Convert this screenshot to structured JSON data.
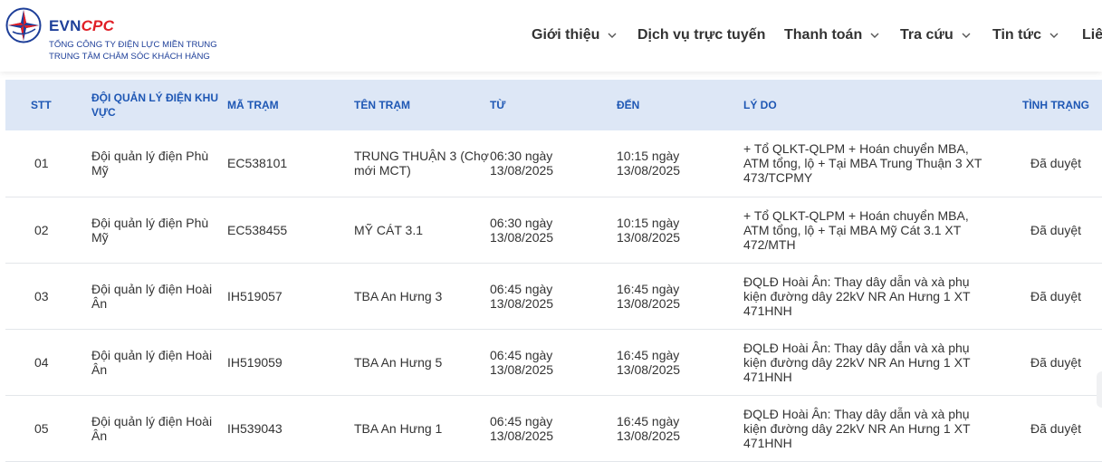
{
  "brand": {
    "name_part1": "EVN",
    "name_part2": "CPC",
    "line1": "TỔNG CÔNG TY ĐIỆN LỰC MIỀN TRUNG",
    "line2": "TRUNG TÂM CHĂM SÓC KHÁCH HÀNG",
    "colors": {
      "primary": "#1e3f99",
      "accent": "#e01f26"
    }
  },
  "nav": {
    "items": [
      {
        "label": "Giới thiệu",
        "has_dropdown": true
      },
      {
        "label": "Dịch vụ trực tuyến",
        "has_dropdown": false
      },
      {
        "label": "Thanh toán",
        "has_dropdown": true
      },
      {
        "label": "Tra cứu",
        "has_dropdown": true
      },
      {
        "label": "Tin tức",
        "has_dropdown": true
      },
      {
        "label": "Liê",
        "has_dropdown": false
      }
    ]
  },
  "table": {
    "columns": {
      "stt": "STT",
      "doi": "ĐỘI QUẢN LÝ ĐIỆN KHU VỰC",
      "ma_tram": "MÃ TRẠM",
      "ten_tram": "TÊN TRẠM",
      "tu": "TỪ",
      "den": "ĐẾN",
      "ly_do": "LÝ DO",
      "tinh_trang": "TÌNH TRẠNG"
    },
    "rows": [
      {
        "stt": "01",
        "doi": "Đội quản lý điện Phù Mỹ",
        "ma_tram": "EC538101",
        "ten_tram": "TRUNG THUẬN 3 (Chợ mới MCT)",
        "tu": "06:30 ngày 13/08/2025",
        "den": "10:15 ngày 13/08/2025",
        "ly_do": "+ Tổ QLKT-QLPM + Hoán chuyển MBA, ATM tổng, lộ + Tại MBA Trung Thuận 3 XT 473/TCPMY",
        "tinh_trang": "Đã duyệt"
      },
      {
        "stt": "02",
        "doi": "Đội quản lý điện Phù Mỹ",
        "ma_tram": "EC538455",
        "ten_tram": "MỸ CÁT 3.1",
        "tu": "06:30 ngày 13/08/2025",
        "den": "10:15 ngày 13/08/2025",
        "ly_do": "+ Tổ QLKT-QLPM + Hoán chuyển MBA, ATM tổng, lộ + Tại MBA Mỹ Cát 3.1 XT 472/MTH",
        "tinh_trang": "Đã duyệt"
      },
      {
        "stt": "03",
        "doi": "Đội quản lý điện Hoài Ân",
        "ma_tram": "IH519057",
        "ten_tram": "TBA An Hưng 3",
        "tu": "06:45 ngày 13/08/2025",
        "den": "16:45 ngày 13/08/2025",
        "ly_do": "ĐQLĐ Hoài Ân: Thay dây dẫn và xà phụ kiện đường dây 22kV NR An Hưng 1 XT 471HNH",
        "tinh_trang": "Đã duyệt"
      },
      {
        "stt": "04",
        "doi": "Đội quản lý điện Hoài Ân",
        "ma_tram": "IH519059",
        "ten_tram": "TBA An Hưng 5",
        "tu": "06:45 ngày 13/08/2025",
        "den": "16:45 ngày 13/08/2025",
        "ly_do": "ĐQLĐ Hoài Ân: Thay dây dẫn và xà phụ kiện đường dây 22kV NR An Hưng 1 XT 471HNH",
        "tinh_trang": "Đã duyệt"
      },
      {
        "stt": "05",
        "doi": "Đội quản lý điện Hoài Ân",
        "ma_tram": "IH539043",
        "ten_tram": "TBA An Hưng 1",
        "tu": "06:45 ngày 13/08/2025",
        "den": "16:45 ngày 13/08/2025",
        "ly_do": "ĐQLĐ Hoài Ân: Thay dây dẫn và xà phụ kiện đường dây 22kV NR An Hưng 1 XT 471HNH",
        "tinh_trang": "Đã duyệt"
      }
    ]
  }
}
